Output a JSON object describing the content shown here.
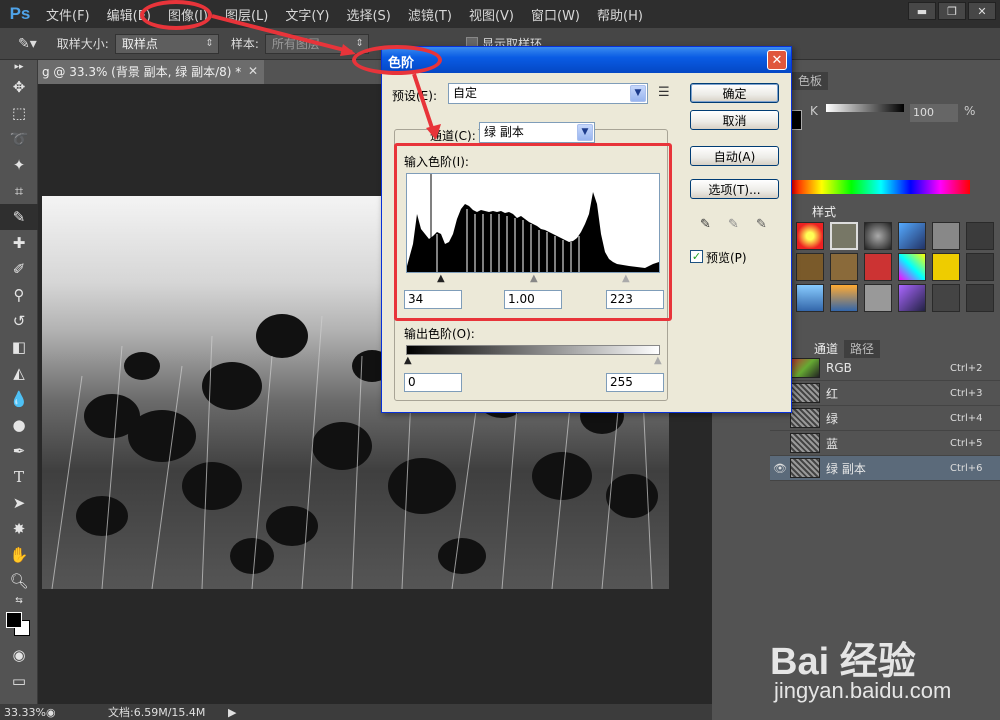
{
  "app": {
    "logo": "Ps"
  },
  "menu": [
    "文件(F)",
    "编辑(E)",
    "图像(I)",
    "图层(L)",
    "文字(Y)",
    "选择(S)",
    "滤镜(T)",
    "视图(V)",
    "窗口(W)",
    "帮助(H)"
  ],
  "window_controls": [
    "▬",
    "❐",
    "✕"
  ],
  "options": {
    "sample_size_label": "取样大小:",
    "sample_size_value": "取样点",
    "sample_label": "样本:",
    "sample_value": "所有图层",
    "show_ring_label": "显示取样环"
  },
  "document": {
    "tab_title": "g @ 33.3% (背景 副本, 绿 副本/8) *",
    "zoom": "33.33%",
    "doc_info": "文档:6.59M/15.4M"
  },
  "color_panel": {
    "tabs": [
      "色板"
    ],
    "k_label": "K",
    "k_value": "100",
    "unit": "%"
  },
  "styles_panel": {
    "tabs": [
      "样式"
    ]
  },
  "channels_panel": {
    "tabs": [
      "通道",
      "路径"
    ],
    "rows": [
      {
        "name": "RGB",
        "shortcut": "Ctrl+2"
      },
      {
        "name": "红",
        "shortcut": "Ctrl+3"
      },
      {
        "name": "绿",
        "shortcut": "Ctrl+4"
      },
      {
        "name": "蓝",
        "shortcut": "Ctrl+5"
      },
      {
        "name": "绿 副本",
        "shortcut": "Ctrl+6"
      }
    ]
  },
  "dialog": {
    "title": "色阶",
    "preset_label": "预设(E):",
    "preset_value": "自定",
    "channel_label": "通道(C):",
    "channel_value": "绿 副本",
    "input_label": "输入色阶(I):",
    "input_black": "34",
    "input_gamma": "1.00",
    "input_white": "223",
    "output_label": "输出色阶(O):",
    "output_black": "0",
    "output_white": "255",
    "btn_ok": "确定",
    "btn_cancel": "取消",
    "btn_auto": "自动(A)",
    "btn_options": "选项(T)...",
    "preview_label": "预览(P)"
  },
  "watermark": {
    "text": "Bai  经验",
    "url": "jingyan.baidu.com"
  },
  "colors": {
    "annotation": "#e8343a",
    "title_bar": "#0a5ce4"
  }
}
